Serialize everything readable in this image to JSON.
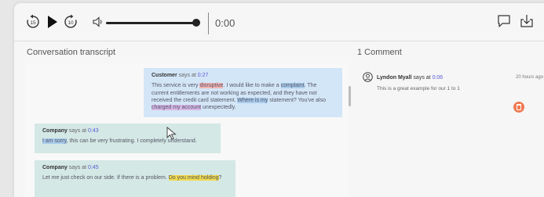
{
  "player": {
    "rewind_seconds": "15",
    "forward_seconds": "10",
    "time": "0:00",
    "volume_level": 1.0
  },
  "transcript": {
    "title": "Conversation transcript",
    "messages": [
      {
        "speaker": "Customer",
        "says": "says at",
        "timestamp": "0:27"
      },
      {
        "speaker": "Company",
        "says": "says at",
        "timestamp": "0:43"
      },
      {
        "speaker": "Company",
        "says": "says at",
        "timestamp": "0:45"
      }
    ]
  },
  "comments": {
    "title": "1 Comment",
    "items": [
      {
        "author": "Lyndon Myall",
        "says": "says at",
        "timestamp": "0:06",
        "ago": "20 hours ago",
        "text": "This is a great example for our 1 to 1"
      }
    ]
  },
  "colors": {
    "highlight_red": "#f3b3b3",
    "highlight_blue": "#a9ccec",
    "highlight_purple": "#d8b8e8",
    "highlight_yellow": "#f2dc4a",
    "customer_bubble": "#d3e6f7",
    "company_bubble": "#d4e8e5",
    "delete_button": "#f07a52"
  },
  "icons": [
    "rewind-15-icon",
    "play-icon",
    "forward-10-icon",
    "volume-icon",
    "comment-icon",
    "download-icon",
    "user-icon",
    "trash-icon",
    "cursor-icon"
  ]
}
